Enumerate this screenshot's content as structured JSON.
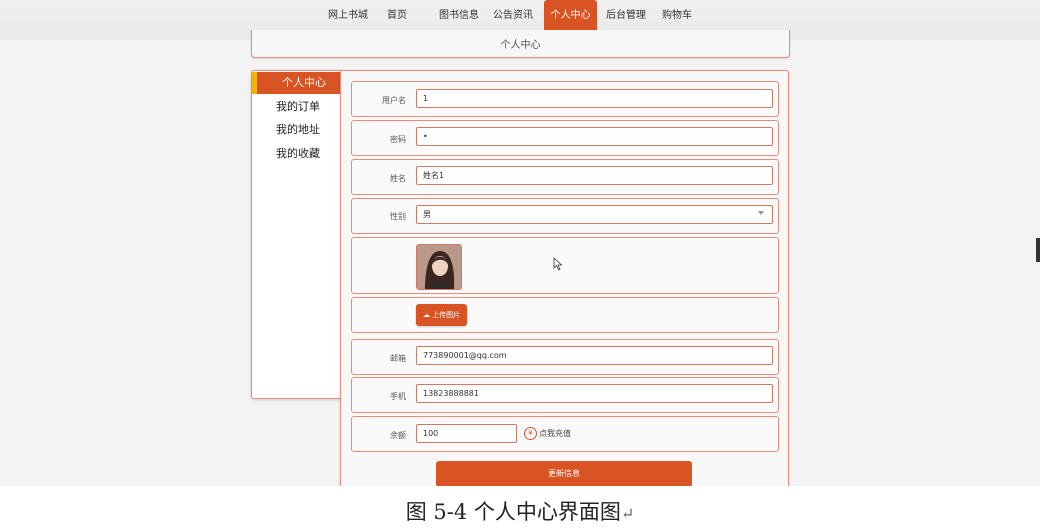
{
  "nav": {
    "brand": "网上书城",
    "items": [
      "首页",
      "图书信息",
      "公告资讯",
      "个人中心",
      "后台管理",
      "购物车"
    ],
    "active": "个人中心"
  },
  "page_title": "个人中心",
  "side_menu": {
    "items": [
      "个人中心",
      "我的订单",
      "我的地址",
      "我的收藏"
    ],
    "active": "个人中心"
  },
  "form": {
    "username_label": "用户名",
    "username_value": "1",
    "password_label": "密码",
    "password_value": "•",
    "name_label": "姓名",
    "name_value": "姓名1",
    "gender_label": "性别",
    "gender_value": "男",
    "upload_label": "上传图片",
    "email_label": "邮箱",
    "email_value": "773890001@qq.com",
    "phone_label": "手机",
    "phone_value": "13823888881",
    "balance_label": "余额",
    "balance_value": "100",
    "recharge_icon": "¥",
    "recharge_label": "点我充值",
    "submit_label": "更新信息"
  },
  "caption": {
    "text": "图 5-4 个人中心界面图",
    "return_mark": "↵"
  },
  "colors": {
    "accent": "#d85424",
    "active_underline": "#f1b400",
    "panel_border": "#e58d7d"
  }
}
